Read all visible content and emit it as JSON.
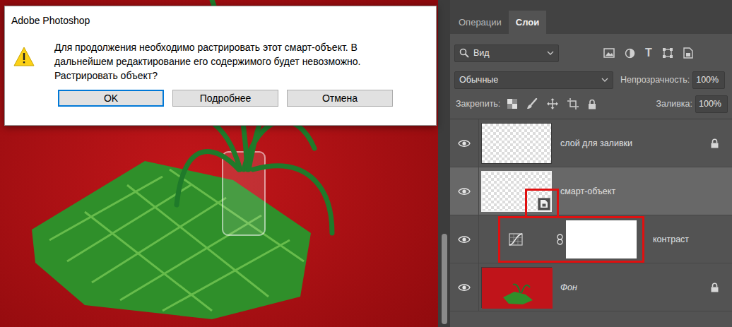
{
  "dialog": {
    "title": "Adobe Photoshop",
    "message_lines": [
      "Для продолжения необходимо растрировать этот смарт-объект.  В",
      "дальнейшем редактирование его содержимого будет невозможно.",
      "Растрировать объект?"
    ],
    "buttons": [
      {
        "label": "OK",
        "default": true
      },
      {
        "label": "Подробнее",
        "default": false
      },
      {
        "label": "Отмена",
        "default": false
      }
    ]
  },
  "panel": {
    "tabs": [
      {
        "label": "Операции",
        "selected": false
      },
      {
        "label": "Слои",
        "selected": true
      }
    ],
    "filter": {
      "value": "Вид",
      "type_icon": "T"
    },
    "blend_mode": "Обычные",
    "opacity": {
      "label": "Непрозрачность:",
      "value": "100%"
    },
    "lock": {
      "label": "Закрепить:"
    },
    "fill": {
      "label": "Заливка:",
      "value": "100%"
    },
    "layers": [
      {
        "name": "слой для заливки",
        "kind": "pixel",
        "visible": true,
        "selected": false,
        "locked": true,
        "highlighted": false
      },
      {
        "name": "смарт-объект",
        "kind": "smart",
        "visible": true,
        "selected": true,
        "locked": false,
        "highlighted": true
      },
      {
        "name": "контраст",
        "kind": "adjustment",
        "visible": true,
        "selected": false,
        "locked": false,
        "highlighted": true
      },
      {
        "name": "Фон",
        "kind": "background",
        "visible": true,
        "selected": false,
        "locked": true,
        "highlighted": false
      }
    ]
  }
}
